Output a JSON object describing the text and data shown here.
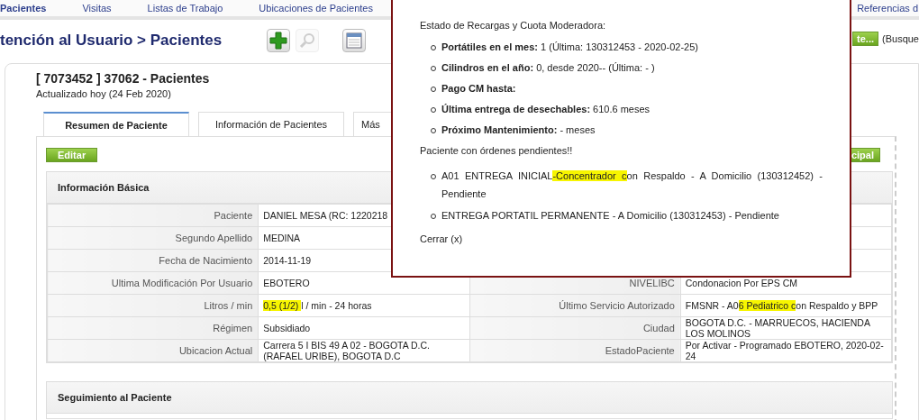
{
  "nav": {
    "items": [
      {
        "label": "Pacientes",
        "selected": true
      },
      {
        "label": "Visitas",
        "selected": false
      },
      {
        "label": "Listas de Trabajo",
        "selected": false
      },
      {
        "label": "Ubicaciones de Pacientes",
        "selected": false
      }
    ],
    "right_link": "Referencias d"
  },
  "header": {
    "title": "tención al Usuario > Pacientes",
    "right_button": "te...",
    "right_text": "(Busque"
  },
  "record": {
    "title": "[ 7073452 ] 37062 - Pacientes",
    "updated": "Actualizado hoy (24 Feb 2020)",
    "tabs": [
      {
        "label": "Resumen de Paciente",
        "selected": true
      },
      {
        "label": "Información de Pacientes",
        "selected": false
      },
      {
        "label": "Más",
        "selected": false
      }
    ],
    "edit_button": "Editar",
    "right_button": "cipal"
  },
  "basic_info": {
    "title": "Información Básica",
    "rows": [
      {
        "label": "Paciente",
        "value": [
          {
            "text": "DANIEL MESA (RC: 1220218",
            "highlight": false
          }
        ]
      },
      {
        "label": "Segundo Apellido",
        "value": [
          {
            "text": "MEDINA",
            "highlight": false
          }
        ]
      },
      {
        "label": "Fecha de Nacimiento",
        "value": [
          {
            "text": "2014-11-19",
            "highlight": false
          }
        ]
      },
      {
        "label": "Ultima Modificación Por Usuario",
        "value": [
          {
            "text": "EBOTERO",
            "highlight": false
          }
        ],
        "label_2": "NIVELIBC",
        "value_2": [
          {
            "text": "Condonacion Por EPS CM",
            "highlight": false
          }
        ]
      },
      {
        "label": "Litros / min",
        "value": [
          {
            "text": "0,5 (1/2) ",
            "highlight": true
          },
          {
            "text": "l / min - 24 horas",
            "highlight": false
          }
        ],
        "label_2": "Último Servicio Autorizado",
        "value_2": [
          {
            "text": "FMSNR - A0",
            "highlight": false
          },
          {
            "text": "6 Pediatrico c",
            "highlight": true
          },
          {
            "text": "on Respaldo y BPP",
            "highlight": false
          }
        ]
      },
      {
        "label": "Régimen",
        "value": [
          {
            "text": "Subsidiado",
            "highlight": false
          }
        ],
        "label_2": "Ciudad",
        "value_2": [
          {
            "text": "BOGOTA D.C. - MARRUECOS, HACIENDA LOS MOLINOS",
            "highlight": false
          }
        ]
      },
      {
        "label": "Ubicacion Actual",
        "value": [
          {
            "text": "Carrera 5 I BIS 49 A 02 - BOGOTA D.C. (RAFAEL URIBE), BOGOTA D.C",
            "highlight": false
          }
        ],
        "label_2": "EstadoPaciente",
        "value_2": [
          {
            "text": "Por Activar - Programado EBOTERO, 2020-02-24",
            "highlight": false
          }
        ]
      }
    ]
  },
  "follow_up": {
    "title": "Seguimiento al Paciente"
  },
  "popup": {
    "heading": "Estado de Recargas y Cuota Moderadora:",
    "items": [
      "**Portátiles en el mes:** 1 (Última: 130312453 - 2020-02-25)",
      "**Cilindros en el año:** 0, desde 2020-- (Última: - )",
      "**Pago CM hasta:**",
      "**Última entrega de desechables:** 610.6 meses",
      "**Próximo Mantenimiento:** - meses"
    ],
    "orders_heading": "Paciente con órdenes pendientes!!",
    "orders": [
      [
        {
          "text": "A01 ENTREGA INICIAL",
          "highlight": false
        },
        {
          "text": "-Concentrador c",
          "highlight": true
        },
        {
          "text": "on Respaldo - A Domicilio (130312452) - Pendiente",
          "highlight": false
        }
      ],
      [
        {
          "text": "ENTREGA PORTATIL PERMANENTE - A Domicilio (130312453) - Pendiente",
          "highlight": false
        }
      ]
    ],
    "close": "Cerrar (x)"
  }
}
